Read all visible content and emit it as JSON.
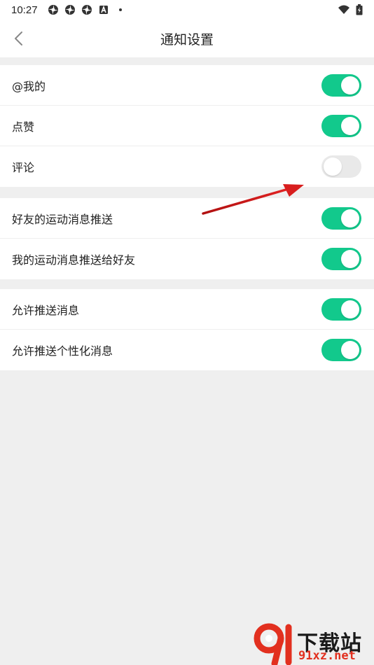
{
  "status_bar": {
    "time": "10:27",
    "left_icons": [
      "notification-icon",
      "notification-icon",
      "notification-icon",
      "app-a-icon",
      "dot-icon"
    ],
    "right_icons": [
      "wifi-icon",
      "battery-icon"
    ]
  },
  "header": {
    "title": "通知设置",
    "back_icon": "chevron-left-icon"
  },
  "sections": [
    {
      "rows": [
        {
          "label": "@我的",
          "enabled": true
        },
        {
          "label": "点赞",
          "enabled": true
        },
        {
          "label": "评论",
          "enabled": false
        }
      ]
    },
    {
      "rows": [
        {
          "label": "好友的运动消息推送",
          "enabled": true
        },
        {
          "label": "我的运动消息推送给好友",
          "enabled": true
        }
      ]
    },
    {
      "rows": [
        {
          "label": "允许推送消息",
          "enabled": true
        },
        {
          "label": "允许推送个性化消息",
          "enabled": true
        }
      ]
    }
  ],
  "colors": {
    "toggle_on": "#12c98c",
    "toggle_off": "#e9e9e9",
    "background": "#efefef",
    "annotation_arrow": "#d81e1e"
  },
  "watermark": {
    "logo_text": "91",
    "title": "下载站",
    "site": "91xz.net"
  }
}
